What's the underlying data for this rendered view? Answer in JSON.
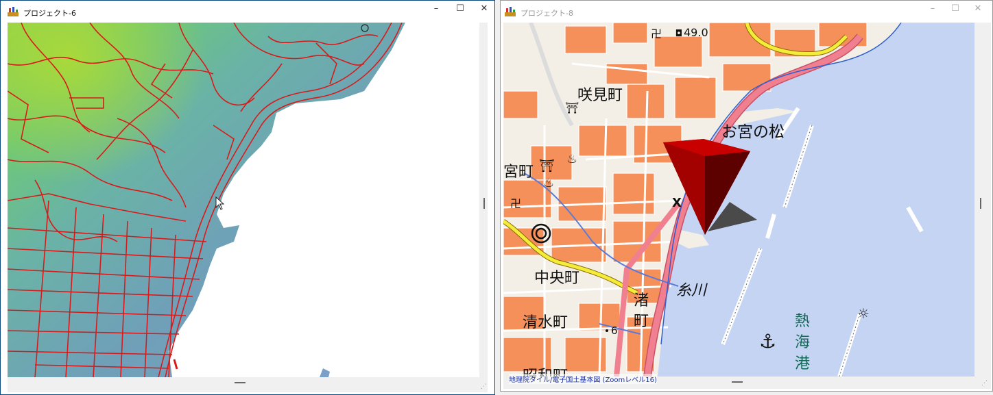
{
  "windows": [
    {
      "title": "プロジェクト-6",
      "controls": {
        "minimize": "–",
        "maximize": "☐",
        "close": "✕"
      }
    },
    {
      "title": "プロジェクト-8",
      "controls": {
        "minimize": "–",
        "maximize": "☐",
        "close": "✕"
      }
    }
  ],
  "map": {
    "labels": {
      "elevation": "49.0",
      "sakimicho": "咲見町",
      "omiyanomatsu": "お宮の松",
      "miyamachi": "宮町",
      "chuocho": "中央町",
      "itokawa": "糸川",
      "nagisa1": "渚",
      "nagisa2": "町",
      "shimizucho": "清水町",
      "showacho": "昭和町",
      "atami1": "熱",
      "atami2": "海",
      "atami3": "港",
      "spot6": "6",
      "x_mark": "X"
    },
    "credit": "地理院タイル/電子国土基本図 (Zoomレベル16)"
  },
  "colors": {
    "road_red": "#d81a1a",
    "sea_blue": "#c4d4f2",
    "map_block": "#f5905a",
    "pin_red": "#c00000"
  }
}
